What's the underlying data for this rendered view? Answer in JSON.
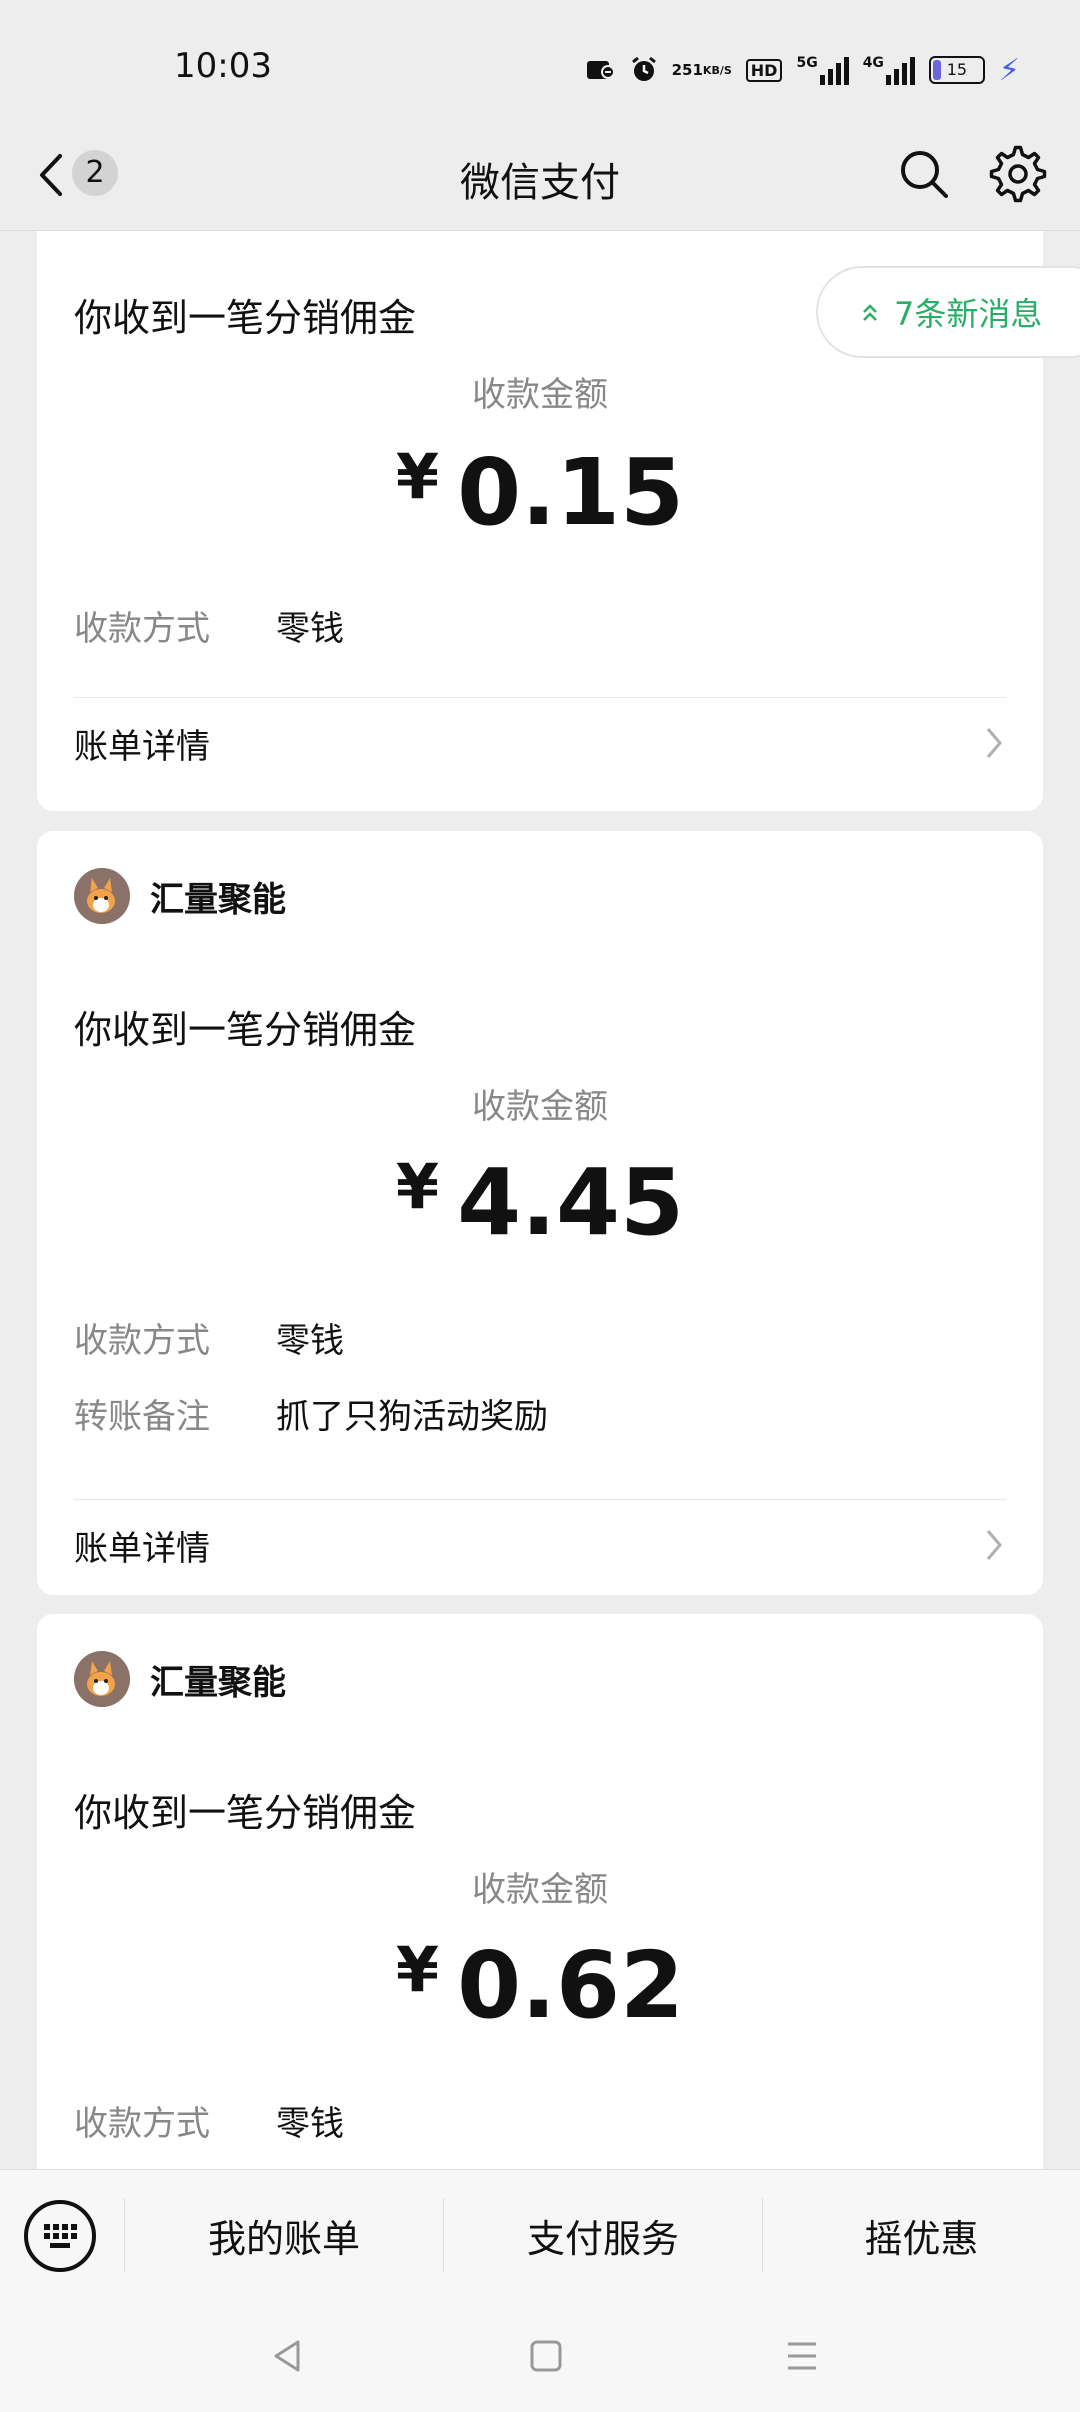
{
  "status_bar": {
    "time": "10:03",
    "speed_value": "251",
    "speed_unit": "KB/S",
    "hd_label": "HD",
    "network_1": "5G",
    "network_2": "4G",
    "battery_level": "15"
  },
  "navbar": {
    "badge_count": "2",
    "title": "微信支付"
  },
  "new_messages": {
    "label": "7条新消息"
  },
  "cards": [
    {
      "title": "你收到一笔分销佣金",
      "amount_label": "收款金额",
      "currency": "¥",
      "amount": "0.15",
      "rows": [
        {
          "key": "收款方式",
          "value": "零钱"
        }
      ],
      "detail_label": "账单详情"
    },
    {
      "sender": "汇量聚能",
      "title": "你收到一笔分销佣金",
      "amount_label": "收款金额",
      "currency": "¥",
      "amount": "4.45",
      "rows": [
        {
          "key": "收款方式",
          "value": "零钱"
        },
        {
          "key": "转账备注",
          "value": "抓了只狗活动奖励"
        }
      ],
      "detail_label": "账单详情"
    },
    {
      "sender": "汇量聚能",
      "title": "你收到一笔分销佣金",
      "amount_label": "收款金额",
      "currency": "¥",
      "amount": "0.62",
      "rows": [
        {
          "key": "收款方式",
          "value": "零钱"
        }
      ]
    }
  ],
  "bottom_menu": {
    "items": [
      "我的账单",
      "支付服务",
      "摇优惠"
    ]
  },
  "colors": {
    "accent_green": "#2aae67",
    "background": "#ededed"
  }
}
